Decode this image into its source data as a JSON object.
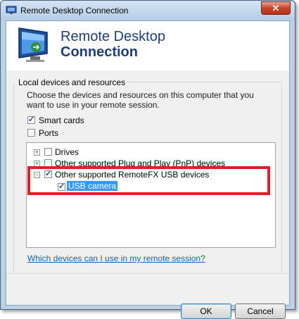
{
  "window": {
    "title": "Remote Desktop Connection",
    "close_glyph": "✕"
  },
  "header": {
    "title_line1": "Remote Desktop",
    "title_line2": "Connection"
  },
  "group": {
    "label": "Local devices and resources",
    "description": "Choose the devices and resources on this computer that you want to use in your remote session.",
    "smart_cards": {
      "label": "Smart cards",
      "checked": true
    },
    "ports": {
      "label": "Ports",
      "checked": false
    }
  },
  "tree": {
    "items": [
      {
        "label": "Drives",
        "expander": "+",
        "checked": false
      },
      {
        "label": "Other supported Plug and Play (PnP) devices",
        "expander": "+",
        "checked": false
      },
      {
        "label": "Other supported RemoteFX USB devices",
        "expander": "−",
        "checked": true
      },
      {
        "label": "USB camera",
        "checked": true,
        "selected": true
      }
    ]
  },
  "help_link": "Which devices can I use in my remote session?",
  "buttons": {
    "ok": "OK",
    "cancel": "Cancel"
  },
  "check_glyph": "✓",
  "colors": {
    "highlight_box": "#e01f2a",
    "selection": "#3399ff",
    "link": "#0066cc",
    "title_text": "#1f3d78"
  },
  "icons": {
    "title": "remote-desktop-icon",
    "logo": "remote-desktop-monitor-icon"
  }
}
